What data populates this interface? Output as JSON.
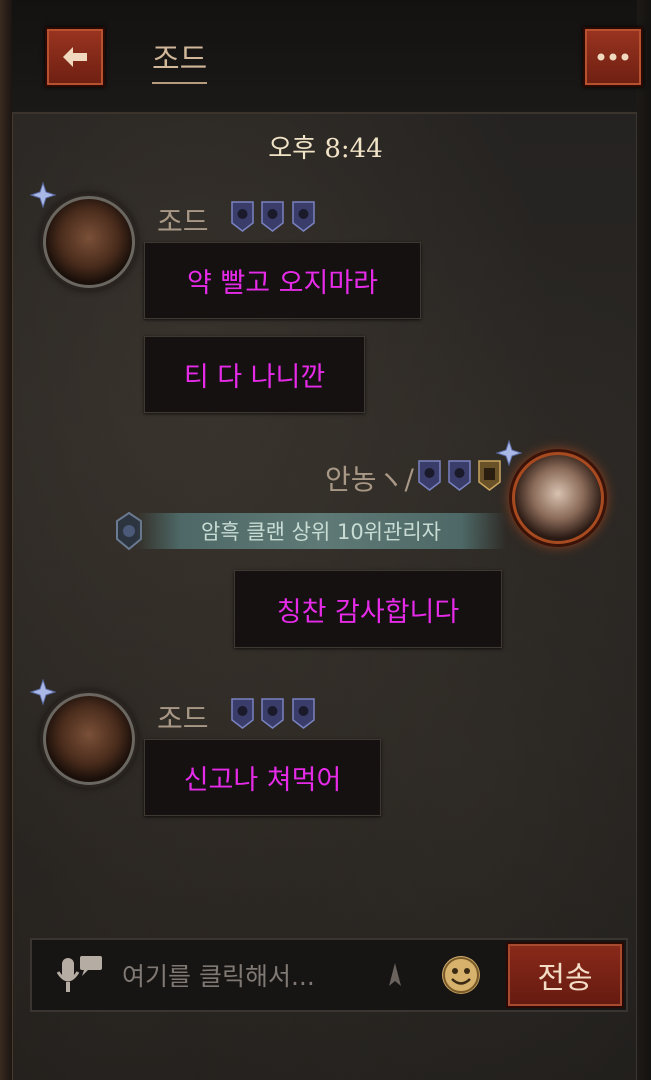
{
  "header": {
    "title": "조드",
    "back_icon": "arrow-left-icon",
    "more_icon": "more-dots-icon"
  },
  "chat": {
    "timestamp": "오후 8:44",
    "messages": [
      {
        "sender": "조드",
        "side": "left",
        "texts": [
          "약 빨고 오지마라",
          "티 다 나니깐"
        ]
      },
      {
        "sender": "안농ヽ/",
        "side": "right",
        "title": "암흑 클랜 상위 10위관리자",
        "texts": [
          "칭찬 감사합니다"
        ]
      },
      {
        "sender": "조드",
        "side": "left",
        "texts": [
          "신고나 쳐먹어"
        ]
      }
    ]
  },
  "input": {
    "placeholder": "여기를 클릭해서...",
    "send_label": "전송",
    "mic_icon": "microphone-icon",
    "emoji_icon": "smiley-icon"
  },
  "colors": {
    "message_text": "#e62be8",
    "accent_button": "#8a2a1a",
    "timestamp": "#f1e3c6"
  }
}
